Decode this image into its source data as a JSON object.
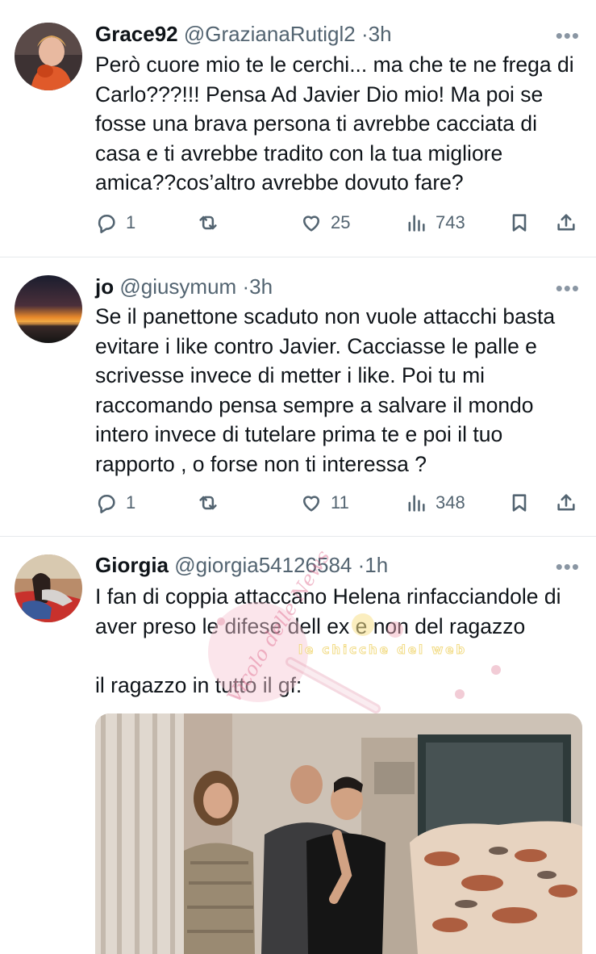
{
  "tweets": [
    {
      "name": "Grace92",
      "handle": "@GrazianaRutigl2",
      "time": "3h",
      "text": "Però cuore mio te le cerchi... ma che te ne frega di Carlo???!!! Pensa Ad Javier Dio mio! Ma poi se fosse una brava persona ti avrebbe cacciata di casa e ti avrebbe tradito con la tua migliore amica??cos’altro avrebbe dovuto fare?",
      "replies": "1",
      "retweets": "",
      "likes": "25",
      "views": "743"
    },
    {
      "name": "jo",
      "handle": "@giusymum",
      "time": "3h",
      "text": "Se il panettone scaduto non vuole attacchi basta evitare i like contro Javier. Cacciasse le palle e scrivesse invece di metter i like. Poi tu mi raccomando pensa sempre a salvare il mondo intero invece di tutelare prima te e poi il tuo rapporto , o forse non ti interessa ?",
      "replies": "1",
      "retweets": "",
      "likes": "11",
      "views": "348"
    },
    {
      "name": "Giorgia",
      "handle": "@giorgia54126584",
      "time": "1h",
      "text": "I fan di coppia attaccano Helena rinfacciandole di aver preso le difese dell ex e non del ragazzo\n\nil ragazzo in tutto il gf:"
    }
  ],
  "separator": "·",
  "more_glyph": "•••",
  "icons": [
    "reply-icon",
    "retweet-icon",
    "like-icon",
    "views-icon",
    "bookmark-icon",
    "share-icon",
    "more-icon"
  ],
  "watermark": {
    "main": "Vicolo delle News",
    "sub": "le chicche del web"
  },
  "colors": {
    "text": "#0f1419",
    "secondary": "#536471",
    "divider": "#e6e9ec"
  }
}
